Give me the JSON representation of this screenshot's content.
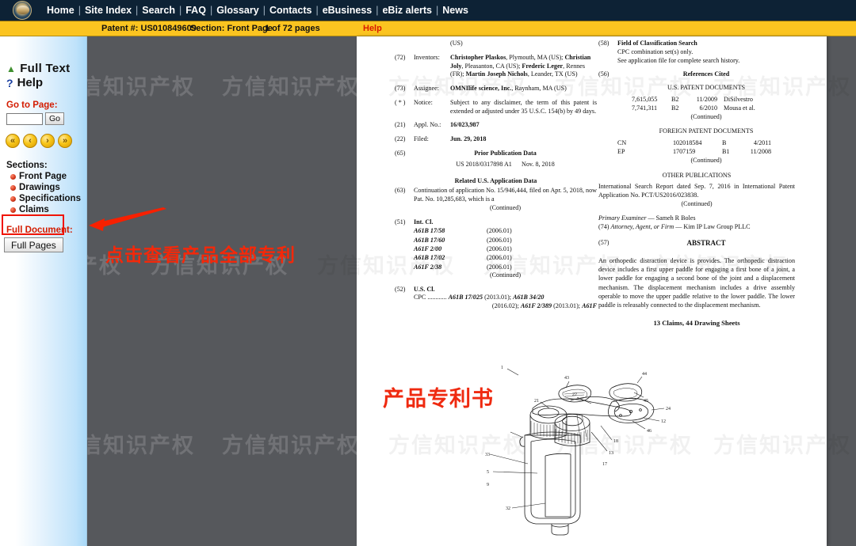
{
  "topnav": {
    "logo_alt": "uspto-seal",
    "links": [
      "Home",
      "Site Index",
      "Search",
      "FAQ",
      "Glossary",
      "Contacts",
      "eBusiness",
      "eBiz alerts",
      "News"
    ]
  },
  "toolbar": {
    "patent_label": "Patent #: US010849609",
    "section_label": "Section: Front Page",
    "pages_label": "1 of 72 pages",
    "help_label": "Help",
    "bg_color": "#fbc420",
    "help_color": "#d91b00"
  },
  "sidebar": {
    "full_text": "Full Text",
    "help": "Help",
    "go_to_page_label": "Go to Page:",
    "page_input_value": "",
    "page_input_placeholder": "",
    "go_button": "Go",
    "nav_arrows": [
      "«",
      "‹",
      "›",
      "»"
    ],
    "sections_label": "Sections:",
    "sections": [
      "Front Page",
      "Drawings",
      "Specifications",
      "Claims"
    ],
    "full_document_label": "Full Document:",
    "full_pages_button": "Full Pages"
  },
  "annotations": {
    "arrow_note": "点击查看产品全部专利",
    "doc_note": "产品专利书",
    "highlight_color": "#f01400"
  },
  "watermark": {
    "text": "方信知识产权"
  },
  "document": {
    "left_column": {
      "country_top": "(US)",
      "inventors": {
        "num": "(72)",
        "label": "Inventors:",
        "entries": [
          {
            "name": "Christopher Plaskos",
            "place": ", Plymouth, MA (US);"
          },
          {
            "name": "Christian Joly",
            "place": ", Pleasanton, CA (US);"
          },
          {
            "name": "Frederic Leger",
            "place": ", Rennes (FR);"
          },
          {
            "name": "Martin Joseph Nichols",
            "place": ", Leander, TX (US)"
          }
        ]
      },
      "assignee": {
        "num": "(73)",
        "label": "Assignee:",
        "name": "OMNIlife science, Inc.",
        "place": ", Raynham, MA (US)"
      },
      "notice": {
        "num": "( * )",
        "label": "Notice:",
        "text": "Subject to any disclaimer, the term of this patent is extended or adjusted under 35 U.S.C. 154(b) by 49 days."
      },
      "appl_no": {
        "num": "(21)",
        "label": "Appl. No.:",
        "value": "16/023,987"
      },
      "filed": {
        "num": "(22)",
        "label": "Filed:",
        "value": "Jun. 29, 2018"
      },
      "prior_pub": {
        "num": "(65)",
        "heading": "Prior Publication Data",
        "value": "US 2018/0317898 A1",
        "date": "Nov. 8, 2018"
      },
      "related_heading": "Related U.S. Application Data",
      "related": {
        "num": "(63)",
        "text": "Continuation of application No. 15/946,444, filed on Apr. 5, 2018, now Pat. No. 10,285,683, which is a",
        "continued": "(Continued)"
      },
      "int_cl": {
        "num": "(51)",
        "label": "Int. Cl.",
        "rows": [
          {
            "code": "A61B 17/58",
            "year": "(2006.01)"
          },
          {
            "code": "A61B 17/60",
            "year": "(2006.01)"
          },
          {
            "code": "A61F 2/00",
            "year": "(2006.01)"
          },
          {
            "code": "A61B 17/02",
            "year": "(2006.01)"
          },
          {
            "code": "A61F 2/38",
            "year": "(2006.01)"
          }
        ],
        "continued": "(Continued)"
      },
      "us_cl": {
        "num": "(52)",
        "label": "U.S. Cl.",
        "line1_prefix": "CPC ............",
        "line1_a": "A61B 17/025",
        "line1_a_year": "(2013.01);",
        "line1_b": "A61B 34/20",
        "line2_year": "(2016.02);",
        "line2_a": "A61F 2/389",
        "line2_a_year": "(2013.01);",
        "line2_b": "A61F"
      }
    },
    "right_column": {
      "field_of_search": {
        "num": "(58)",
        "heading": "Field of Classification Search",
        "line1": "CPC combination set(s) only.",
        "line2": "See application file for complete search history."
      },
      "references": {
        "num": "(56)",
        "heading": "References Cited",
        "us_heading": "U.S. PATENT DOCUMENTS",
        "us_rows": [
          {
            "number": "7,615,055",
            "kind": "B2",
            "date": "11/2009",
            "name": "DiSilvestro"
          },
          {
            "number": "7,741,311",
            "kind": "B2",
            "date": "6/2010",
            "name": "Mousa et al."
          }
        ],
        "us_continued": "(Continued)",
        "foreign_heading": "FOREIGN PATENT DOCUMENTS",
        "foreign_rows": [
          {
            "country": "CN",
            "number": "102018584",
            "kind": "B",
            "date": "4/2011"
          },
          {
            "country": "EP",
            "number": "1707159",
            "kind": "B1",
            "date": "11/2008"
          }
        ],
        "foreign_continued": "(Continued)"
      },
      "other_publications": {
        "heading": "OTHER PUBLICATIONS",
        "text": "International Search Report dated Sep. 7, 2016 in International Patent Application No. PCT/US2016/023838.",
        "continued": "(Continued)"
      },
      "examiner": {
        "label": "Primary Examiner",
        "dash": "—",
        "name": "Sameh R Boles"
      },
      "attorney": {
        "num": "(74)",
        "label": "Attorney, Agent, or Firm",
        "dash": "—",
        "name": "Kim IP Law Group PLLC"
      },
      "abstract": {
        "num": "(57)",
        "heading": "ABSTRACT",
        "text": "An orthopedic distraction device is provides. The orthopedic distraction device includes a first upper paddle for engaging a first bone of a joint, a lower paddle for engaging a second bone of the joint and a displacement mechanism. The displacement mechanism includes a drive assembly operable to move the upper paddle relative to the lower paddle. The lower paddle is releasably connected to the displacement mechanism."
      },
      "claims_line": "13 Claims, 44 Drawing Sheets"
    },
    "figure": {
      "alt": "orthopedic-distraction-device-drawing",
      "reference_numerals": [
        "1",
        "43",
        "44",
        "45",
        "21",
        "22",
        "24",
        "12",
        "46",
        "18",
        "13",
        "17",
        "33",
        "5",
        "9",
        "32"
      ]
    }
  }
}
